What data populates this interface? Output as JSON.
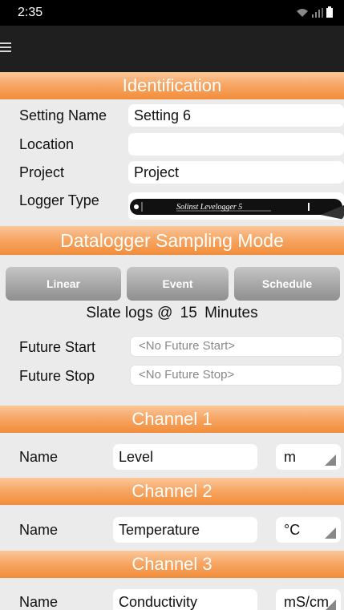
{
  "status_bar": {
    "time": "2:35"
  },
  "identification": {
    "header": "Identification",
    "setting_name_label": "Setting Name",
    "setting_name_value": "Setting 6",
    "location_label": "Location",
    "location_value": "",
    "project_label": "Project",
    "project_value": "Project",
    "logger_type_label": "Logger Type",
    "logger_brand_text": "Solinst Levelogger 5"
  },
  "sampling": {
    "header": "Datalogger Sampling Mode",
    "buttons": [
      "Linear",
      "Event",
      "Schedule"
    ],
    "slate_prefix": "Slate logs @",
    "slate_value": "15",
    "slate_unit": "Minutes",
    "future_start_label": "Future Start",
    "future_start_placeholder": "<No Future Start>",
    "future_stop_label": "Future Stop",
    "future_stop_placeholder": "<No Future Stop>"
  },
  "channels": [
    {
      "header": "Channel 1",
      "name_label": "Name",
      "name_value": "Level",
      "unit": "m"
    },
    {
      "header": "Channel 2",
      "name_label": "Name",
      "name_value": "Temperature",
      "unit": "°C"
    },
    {
      "header": "Channel 3",
      "name_label": "Name",
      "name_value": "Conductivity",
      "unit": "mS/cm"
    }
  ]
}
